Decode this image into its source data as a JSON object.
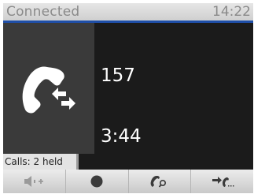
{
  "status": {
    "connection": "Connected",
    "time": "14:22"
  },
  "call": {
    "number": "157",
    "duration": "3:44",
    "icon": "phone-transfer-icon"
  },
  "held": {
    "label": "Calls: 2 held"
  },
  "softkeys": [
    {
      "name": "volume-up",
      "icon": "speaker-plus-icon"
    },
    {
      "name": "record",
      "icon": "record-icon"
    },
    {
      "name": "search-call",
      "icon": "handset-search-icon"
    },
    {
      "name": "transfer",
      "icon": "transfer-call-icon"
    }
  ],
  "colors": {
    "accent": "#1f4fa8",
    "background": "#1b1b1b",
    "panel": "#3a3a3a"
  }
}
